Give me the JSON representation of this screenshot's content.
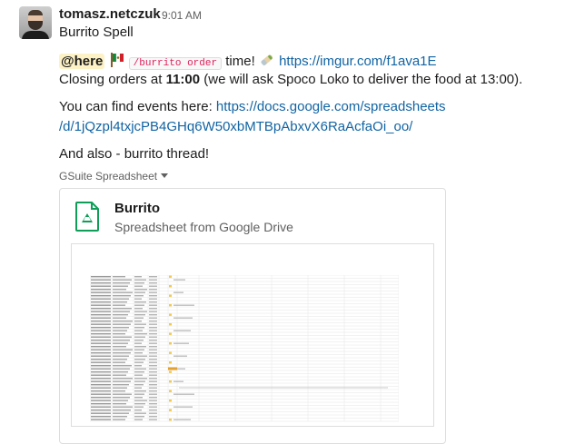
{
  "message": {
    "author": "tomasz.netczuk",
    "time": "9:01 AM",
    "title": "Burrito Spell",
    "line1": {
      "mention": "@here",
      "code": "/burrito order",
      "text_after_code": " time! ",
      "link": "https://imgur.com/f1ava1E"
    },
    "line2": {
      "prefix": "Closing orders at ",
      "bold": "11:00",
      "suffix": " (we will ask Spoco Loko to deliver the food at 13:00)."
    },
    "line3": {
      "prefix": "You can find events here: ",
      "link_part1": "https://docs.google.com/spreadsheets",
      "link_part2": "/d/1jQzpl4txjcPB4GHq6W50xbMTBpAbxvX6RaAcfaOi_oo/"
    },
    "line4": "And also - burrito thread!"
  },
  "attachment": {
    "source_label": "GSuite Spreadsheet",
    "file_title": "Burrito",
    "file_subtitle": "Spreadsheet from Google Drive"
  },
  "colors": {
    "link": "#1264a3",
    "mention_bg": "#fdf2c5",
    "code_text": "#e01e5a",
    "sheets_green": "#0f9d58"
  },
  "icons": [
    "user-avatar",
    "mexican-flag-emoji",
    "burrito-emoji",
    "google-sheets-icon",
    "chevron-down-icon"
  ]
}
